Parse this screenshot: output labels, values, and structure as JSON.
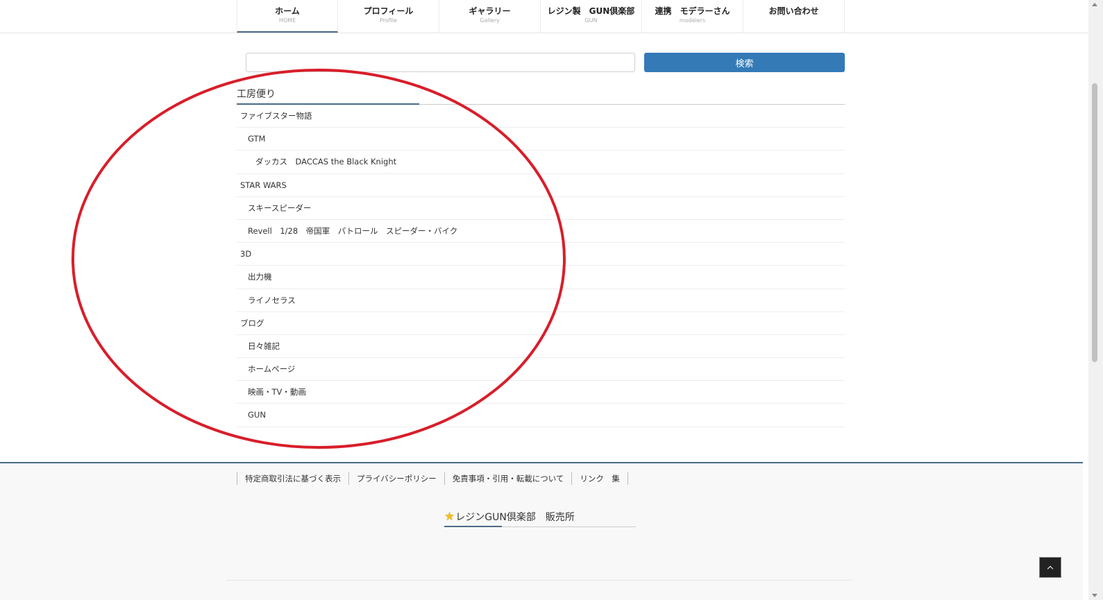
{
  "nav": {
    "items": [
      {
        "label": "ホーム",
        "sub": "HOME"
      },
      {
        "label": "プロフィール",
        "sub": "Profile"
      },
      {
        "label": "ギャラリー",
        "sub": "Gallery"
      },
      {
        "label": "レジン製　GUN倶楽部",
        "sub": "GUN"
      },
      {
        "label": "連携　モデラーさん",
        "sub": "modelers"
      },
      {
        "label": "お問い合わせ",
        "sub": ""
      }
    ]
  },
  "search": {
    "placeholder": "",
    "value": "",
    "button_label": "検索"
  },
  "categories": {
    "title": "工房便り",
    "items": [
      {
        "label": "ファイブスター物語",
        "level": 0
      },
      {
        "label": "GTM",
        "level": 1
      },
      {
        "label": "ダッカス　DACCAS the Black Knight",
        "level": 2
      },
      {
        "label": "STAR WARS",
        "level": 0
      },
      {
        "label": "スキースピーダー",
        "level": 1
      },
      {
        "label": "Revell　1/28　帝国軍　パトロール　スピーダー・バイク",
        "level": 1
      },
      {
        "label": "3D",
        "level": 0
      },
      {
        "label": "出力機",
        "level": 1
      },
      {
        "label": "ライノセラス",
        "level": 1
      },
      {
        "label": "ブログ",
        "level": 0
      },
      {
        "label": "日々雑記",
        "level": 1
      },
      {
        "label": "ホームページ",
        "level": 1
      },
      {
        "label": "映画・TV・動画",
        "level": 1
      },
      {
        "label": "GUN",
        "level": 1
      }
    ]
  },
  "footer": {
    "links": [
      "特定商取引法に基づく表示",
      "プライバシーポリシー",
      "免責事項・引用・転載について",
      "リンク　集"
    ],
    "shop_title": "レジンGUN倶楽部　販売所",
    "shop_icon": "star-icon"
  },
  "colors": {
    "accent": "#4a6b86",
    "button": "#337ab7",
    "annotation": "#d81e2a"
  }
}
